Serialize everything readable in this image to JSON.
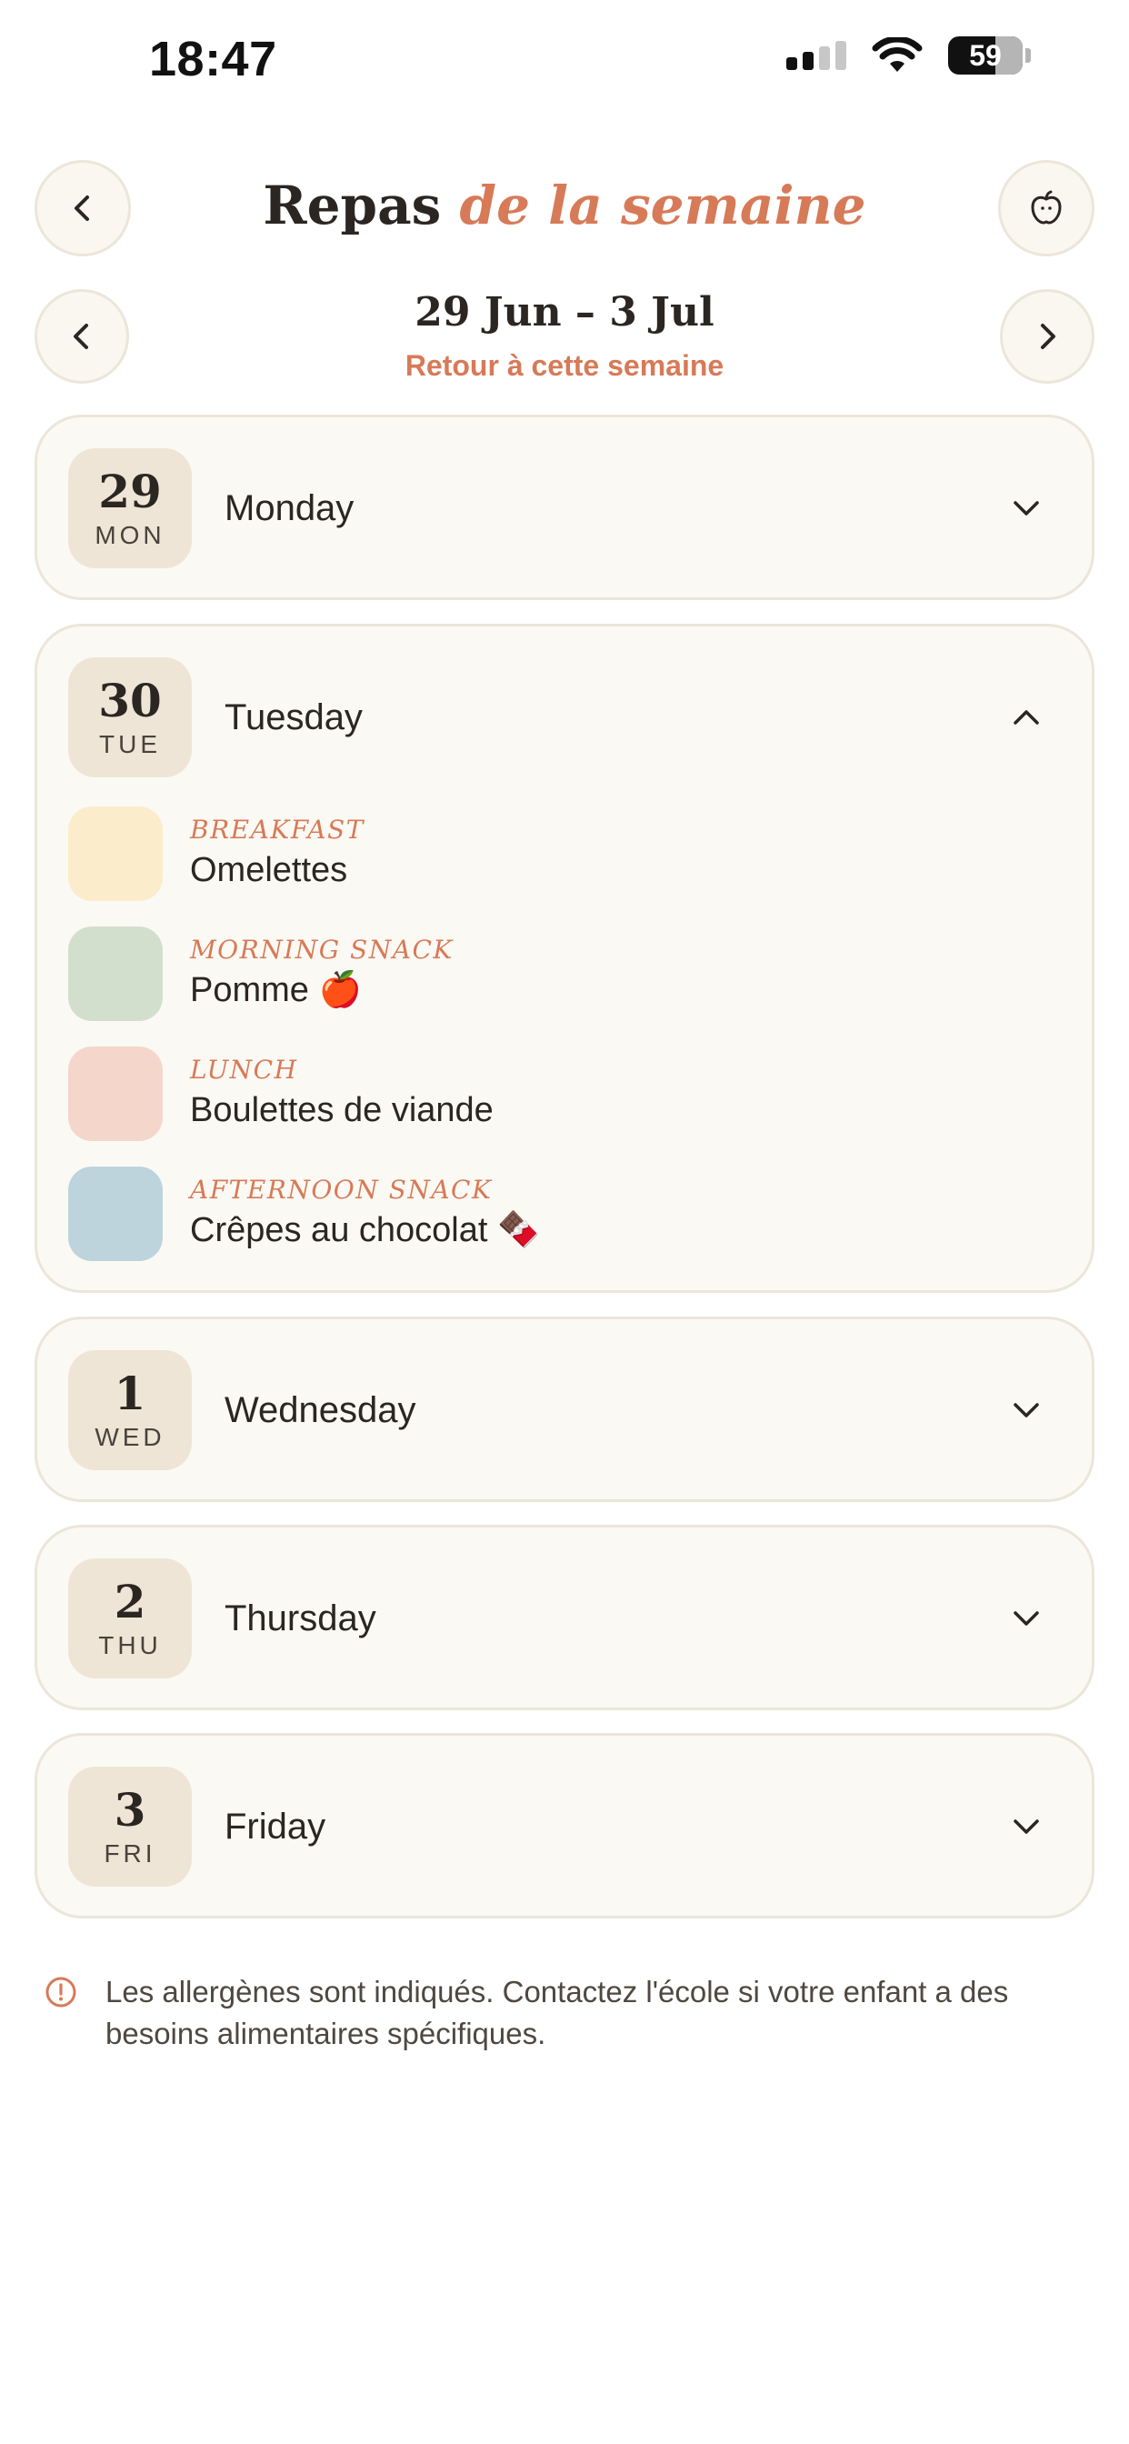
{
  "status_bar": {
    "time": "18:47",
    "battery": "59"
  },
  "header": {
    "title_main": "Repas",
    "title_accent": "de la semaine"
  },
  "week": {
    "range": "29 Jun – 3 Jul",
    "back_link": "Retour à cette semaine"
  },
  "days": [
    {
      "num": "29",
      "abbr": "MON",
      "name": "Monday",
      "expanded": false
    },
    {
      "num": "30",
      "abbr": "TUE",
      "name": "Tuesday",
      "expanded": true,
      "meals": [
        {
          "label": "BREAKFAST",
          "dish": "Omelettes",
          "color": "#fbeccb"
        },
        {
          "label": "MORNING SNACK",
          "dish": "Pomme 🍎",
          "color": "#d3dfcd"
        },
        {
          "label": "LUNCH",
          "dish": "Boulettes de viande",
          "color": "#f5d6cb"
        },
        {
          "label": "AFTERNOON SNACK",
          "dish": "Crêpes au chocolat 🍫",
          "color": "#bdd4dd"
        }
      ]
    },
    {
      "num": "1",
      "abbr": "WED",
      "name": "Wednesday",
      "expanded": false
    },
    {
      "num": "2",
      "abbr": "THU",
      "name": "Thursday",
      "expanded": false
    },
    {
      "num": "3",
      "abbr": "FRI",
      "name": "Friday",
      "expanded": false
    }
  ],
  "notice": {
    "text": "Les allergènes sont indiqués. Contactez l'école si votre enfant a des besoins alimentaires spécifiques."
  },
  "colors": {
    "accent": "#d77a57",
    "card_bg": "#fbf9f4",
    "chip_bg": "#efe5d6"
  }
}
